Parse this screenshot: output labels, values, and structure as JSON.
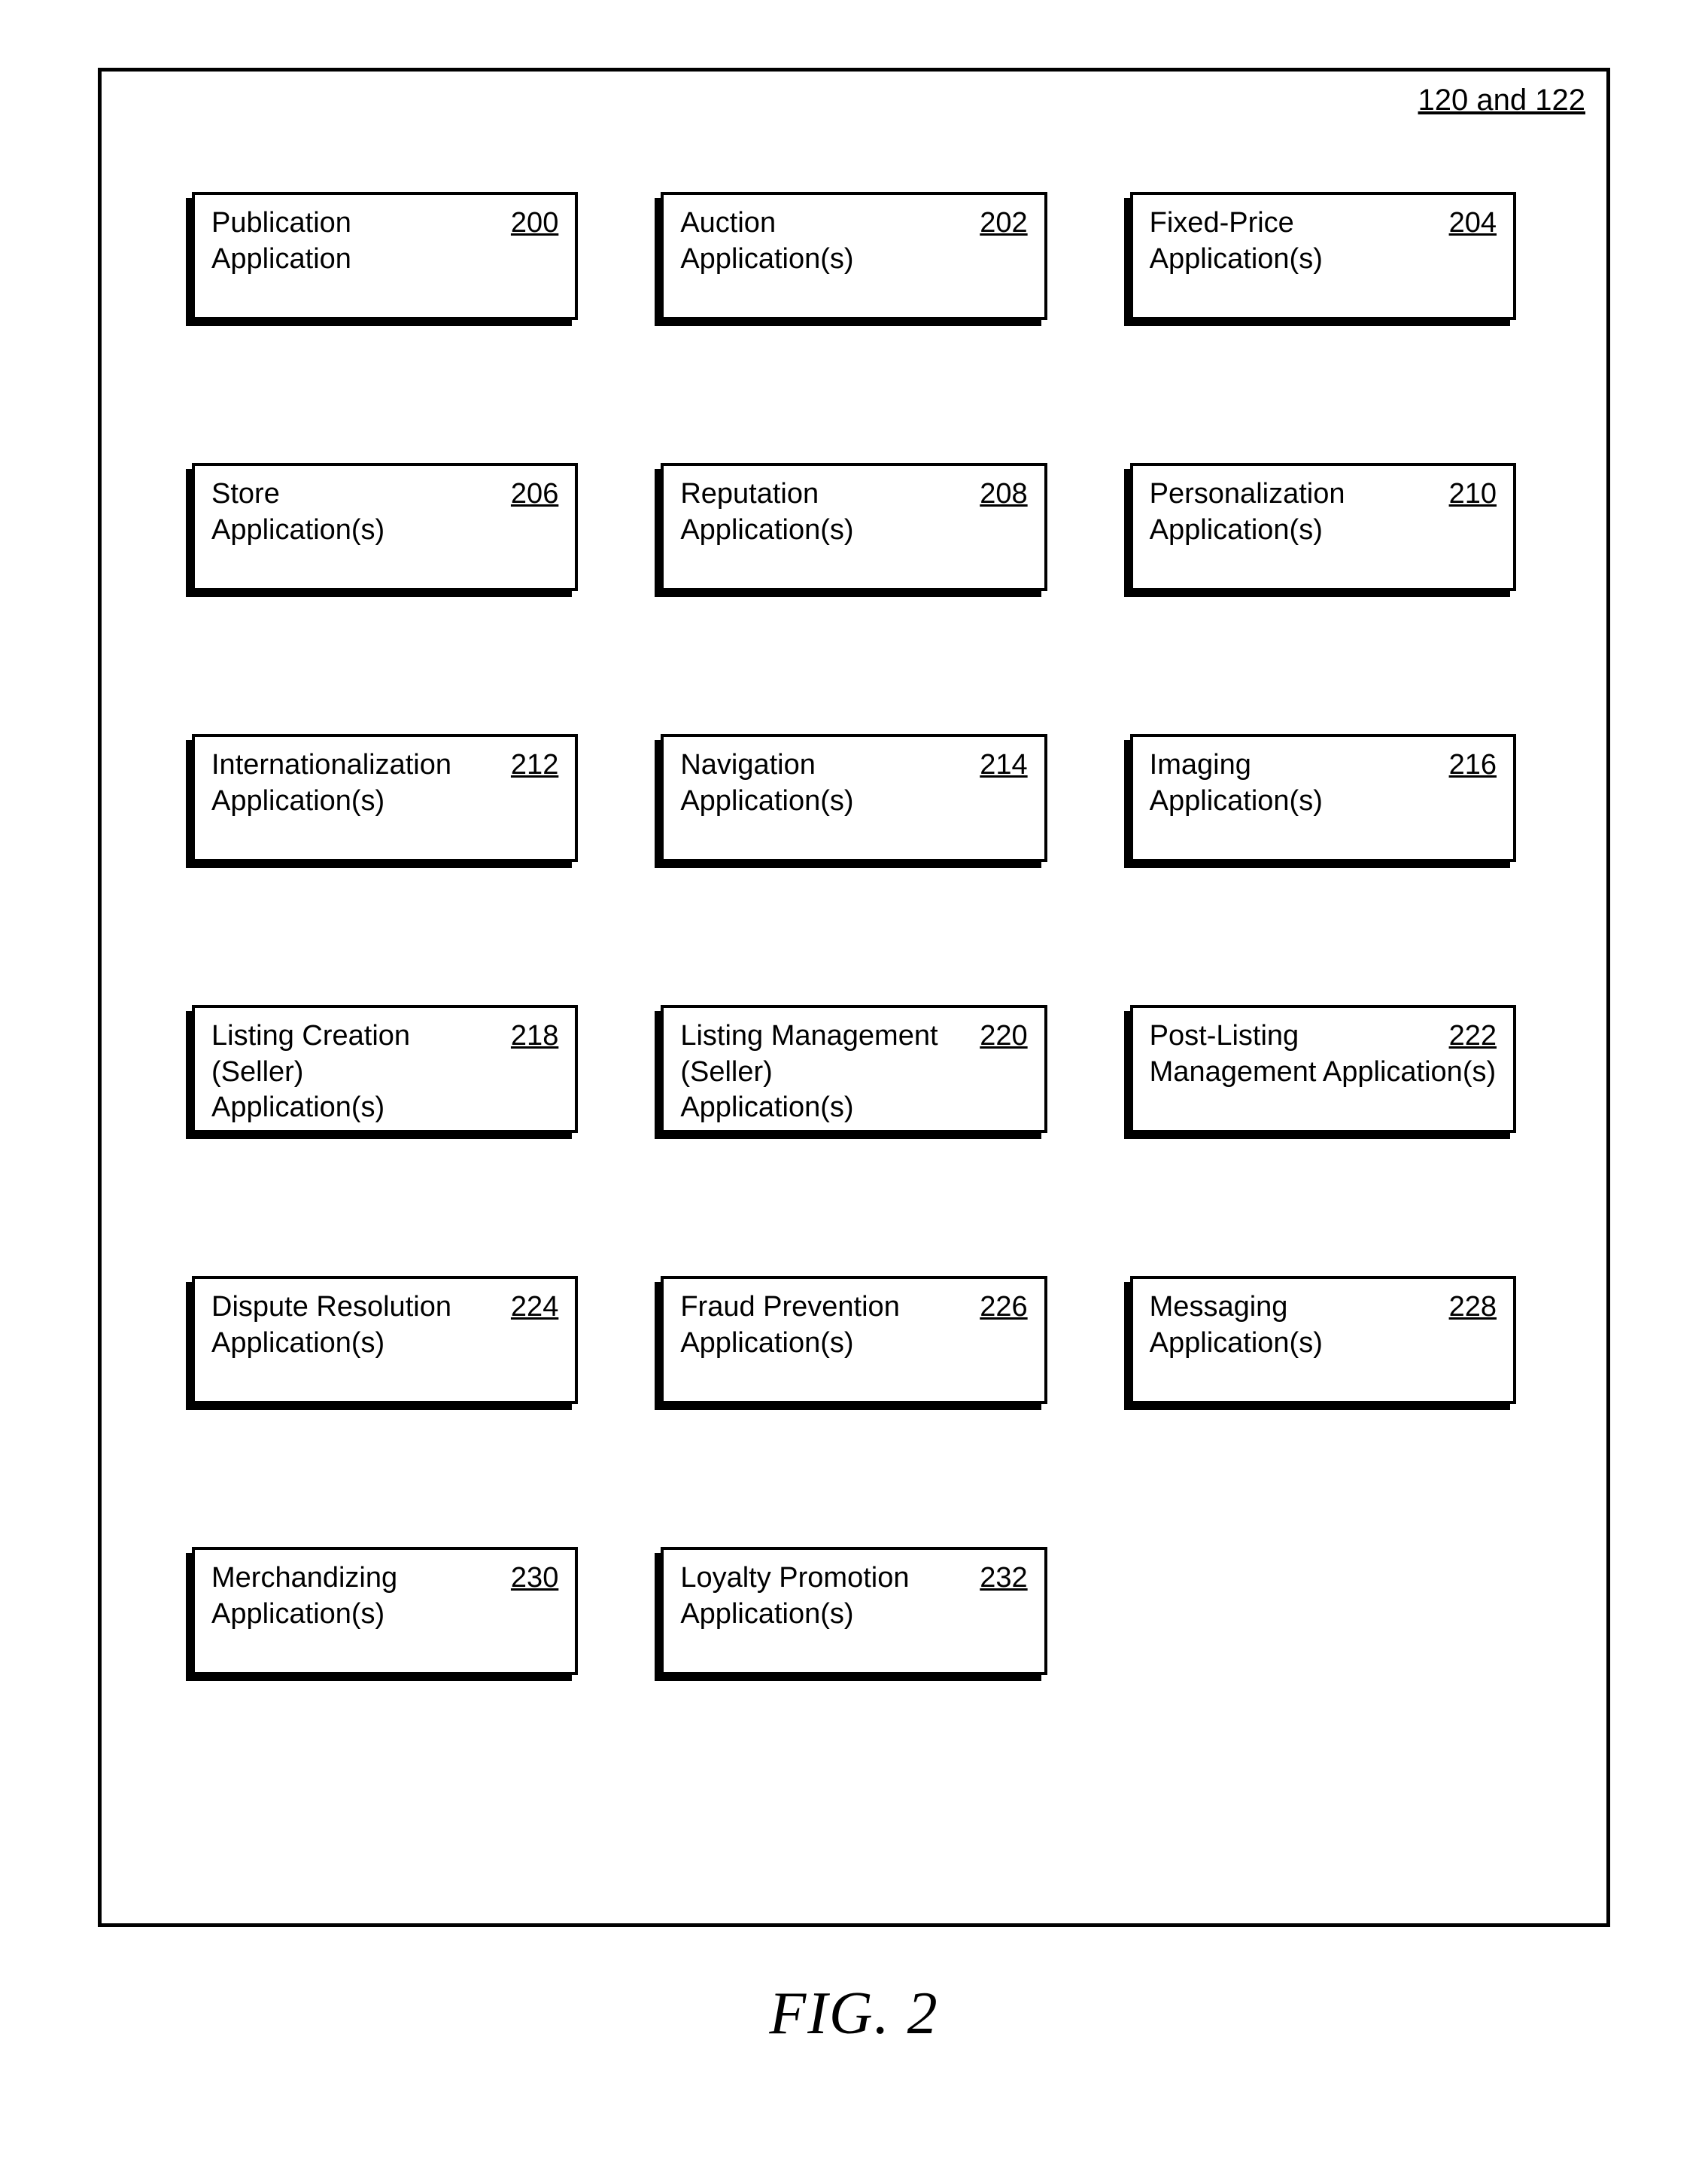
{
  "outerLabel": "120 and 122",
  "caption": "FIG. 2",
  "boxes": [
    {
      "label_line1": "Publication",
      "label_line2": "Application",
      "num": "200"
    },
    {
      "label_line1": "Auction",
      "label_line2": "Application(s)",
      "num": "202"
    },
    {
      "label_line1": "Fixed-Price",
      "label_line2": "Application(s)",
      "num": "204"
    },
    {
      "label_line1": "Store",
      "label_line2": "Application(s)",
      "num": "206"
    },
    {
      "label_line1": "Reputation",
      "label_line2": "Application(s)",
      "num": "208"
    },
    {
      "label_line1": "Personalization",
      "label_line2": "Application(s)",
      "num": "210"
    },
    {
      "label_line1": "Internationalization",
      "label_line2": "Application(s)",
      "num": "212"
    },
    {
      "label_line1": "Navigation",
      "label_line2": "Application(s)",
      "num": "214"
    },
    {
      "label_line1": "Imaging",
      "label_line2": "Application(s)",
      "num": "216"
    },
    {
      "label_line1": "Listing Creation",
      "label_line2": "(Seller) Application(s)",
      "num": "218"
    },
    {
      "label_line1": "Listing Management",
      "label_line2": "(Seller) Application(s)",
      "num": "220"
    },
    {
      "label_line1": "Post-Listing",
      "label_line2": "Management Application(s)",
      "num": "222",
      "wide": true
    },
    {
      "label_line1": "Dispute Resolution",
      "label_line2": "Application(s)",
      "num": "224"
    },
    {
      "label_line1": "Fraud Prevention",
      "label_line2": "Application(s)",
      "num": "226"
    },
    {
      "label_line1": "Messaging",
      "label_line2": "Application(s)",
      "num": "228"
    },
    {
      "label_line1": "Merchandizing",
      "label_line2": "Application(s)",
      "num": "230"
    },
    {
      "label_line1": "Loyalty Promotion",
      "label_line2": "Application(s)",
      "num": "232"
    }
  ]
}
